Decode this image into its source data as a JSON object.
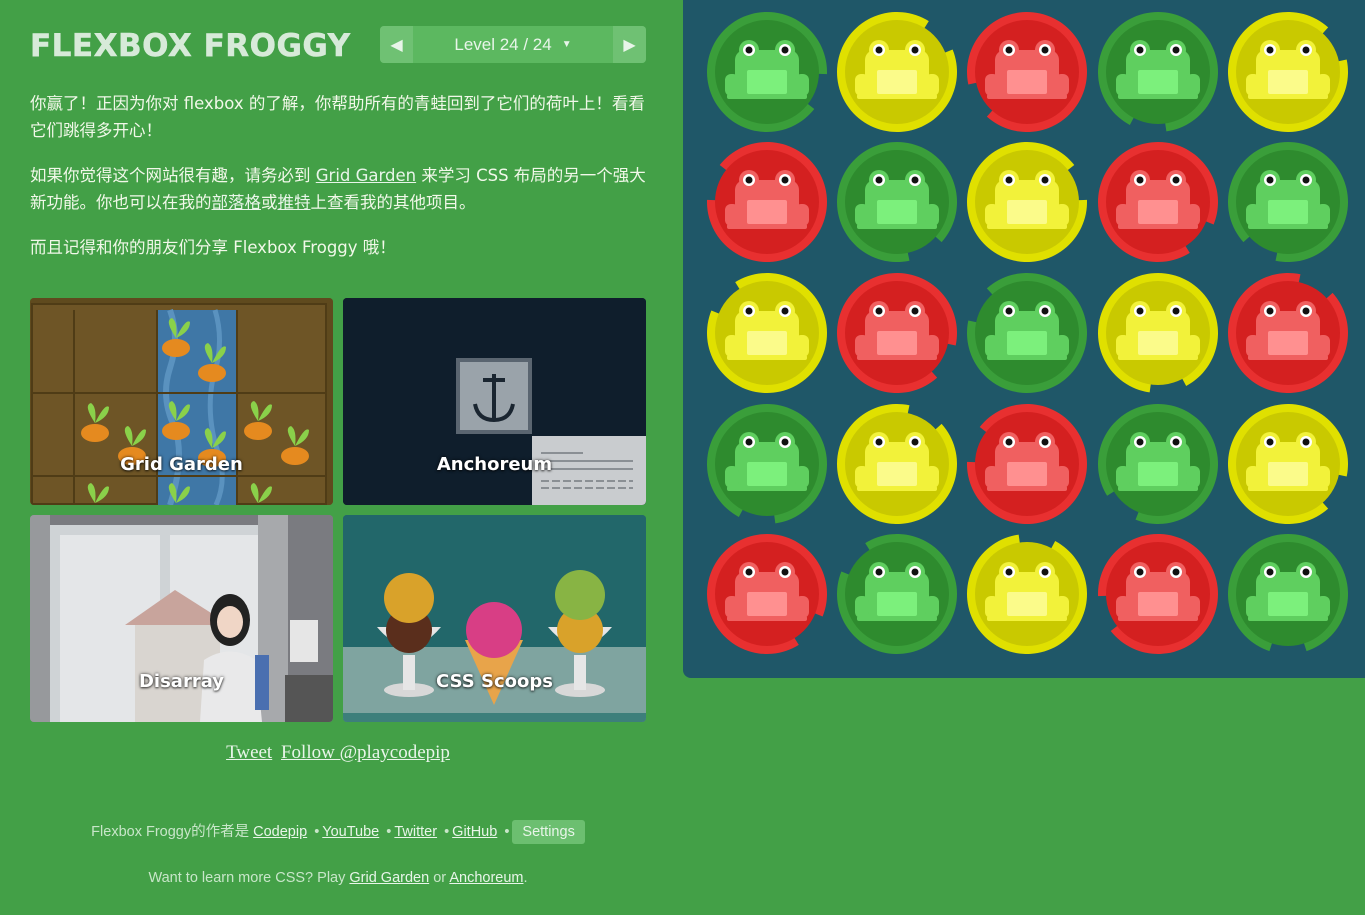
{
  "header": {
    "title": "FLEXBOX FROGGY",
    "level_text": "Level 24 / 24",
    "prev_icon": "triangle-left-icon",
    "next_icon": "triangle-right-icon"
  },
  "instructions": {
    "p1": "你赢了！正因为你对 flexbox 的了解，你帮助所有的青蛙回到了它们的荷叶上！看看它们跳得多开心！",
    "p2_before": "如果你觉得这个网站很有趣，请务必到 ",
    "p2_link1": "Grid Garden",
    "p2_middle": " 来学习 CSS 布局的另一个强大新功能。你也可以在我的",
    "p2_link2": "部落格",
    "p2_or": "或",
    "p2_link3": "推特",
    "p2_after": "上查看我的其他项目。",
    "p3": "而且记得和你的朋友们分享 Flexbox Froggy 哦！"
  },
  "projects": [
    {
      "label": "Grid Garden"
    },
    {
      "label": "Anchoreum"
    },
    {
      "label": "Disarray"
    },
    {
      "label": "CSS Scoops"
    }
  ],
  "social": {
    "tweet": "Tweet",
    "follow": "Follow @playcodepip"
  },
  "footer": {
    "author_text": "Flexbox Froggy的作者是 ",
    "codepip": "Codepip",
    "youtube": "YouTube",
    "twitter": "Twitter",
    "github": "GitHub",
    "bullet": "•",
    "settings": "Settings",
    "learn_prefix": "Want to learn more CSS? Play ",
    "learn_link1": "Grid Garden",
    "learn_or": " or ",
    "learn_link2": "Anchoreum",
    "learn_suffix": "."
  },
  "pond": {
    "colors": {
      "background": "#1f5768",
      "green_pad": "#2e8b2e",
      "green_frog": "#5fcf5f",
      "yellow_pad": "#c9c900",
      "yellow_frog": "#f2f23a",
      "red_pad": "#d42020",
      "red_frog": "#f06060"
    },
    "rows": [
      [
        "green",
        "yellow",
        "red",
        "green",
        "yellow"
      ],
      [
        "red",
        "green",
        "yellow",
        "red",
        "green"
      ],
      [
        "yellow",
        "red",
        "green",
        "yellow",
        "red"
      ],
      [
        "green",
        "yellow",
        "red",
        "green",
        "yellow"
      ],
      [
        "red",
        "green",
        "yellow",
        "red",
        "green"
      ]
    ]
  }
}
